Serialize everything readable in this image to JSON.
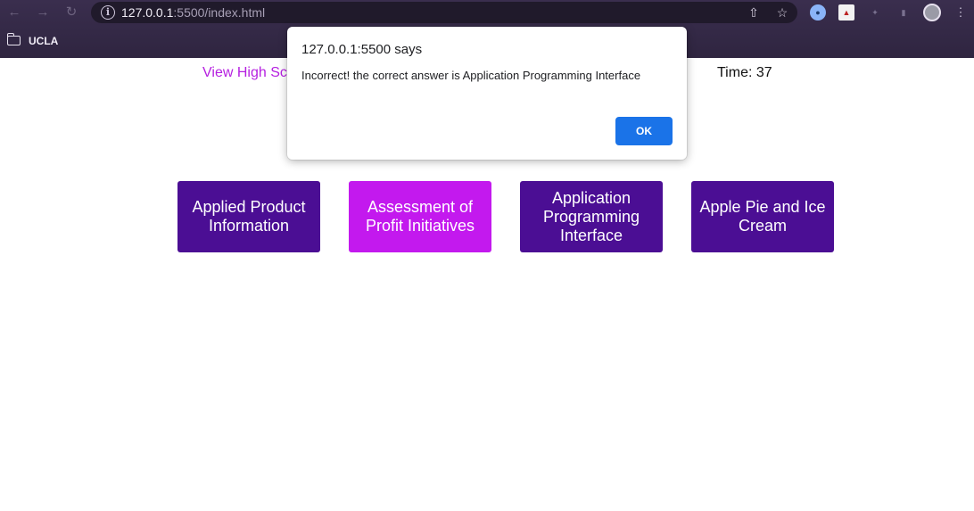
{
  "browser": {
    "url_host": "127.0.0.1",
    "url_rest": ":5500/index.html",
    "bookmark_folder": "UCLA",
    "icons": {
      "back": "arrow-left-icon",
      "forward": "arrow-right-icon",
      "reload": "reload-icon",
      "info": "info-icon",
      "share": "share-icon",
      "bookmark_star": "star-icon",
      "extensions": "puzzle-icon",
      "sidebar": "sidebar-icon",
      "profile": "profile-avatar",
      "menu": "kebab-menu-icon"
    },
    "colors": {
      "chrome_bg": "#3a2e4e",
      "url_bar_bg": "#201a2b"
    }
  },
  "page": {
    "high_scores_link": "View High Sc",
    "timer_label": "Time: 37",
    "answers": [
      {
        "label": "Applied Product Information",
        "state": "default"
      },
      {
        "label": "Assessment of Profit Initiatives",
        "state": "highlighted"
      },
      {
        "label": "Application Programming Interface",
        "state": "default"
      },
      {
        "label": "Apple Pie and Ice Cream",
        "state": "default"
      }
    ],
    "colors": {
      "button_default": "#4b0e94",
      "button_highlighted": "#c319ee",
      "link": "#b51fe0"
    }
  },
  "alert": {
    "title": "127.0.0.1:5500 says",
    "message": "Incorrect! the correct answer is Application Programming Interface",
    "ok_label": "OK",
    "ok_color": "#1a73e8"
  }
}
